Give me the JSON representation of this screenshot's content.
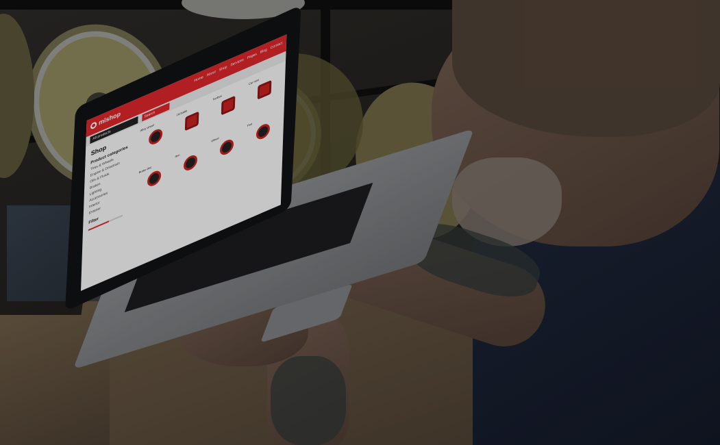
{
  "scene": {
    "description_hidden": "",
    "wall_color": "#2a2826"
  },
  "screen": {
    "brand": {
      "logo": "mlshop",
      "accent": "#d9262a"
    },
    "nav": [
      "Home",
      "About",
      "Shop",
      "Services",
      "Pages",
      "Blog",
      "Contact"
    ],
    "category_button": "All products",
    "search_button": "Search",
    "sidebar": {
      "shop_title": "Shop",
      "categories_title": "Product categories",
      "categories": [
        "Tires & Wheels",
        "Engine & Drivetrain",
        "Oils & Fluids",
        "Brakes",
        "Lighting",
        "Accessories",
        "Interior",
        "Exterior"
      ],
      "filter_title": "Filter"
    },
    "products": [
      {
        "title": "Alloy wheel",
        "price": "",
        "shape": "wheel"
      },
      {
        "title": "Oil bottle",
        "price": "",
        "shape": "square"
      },
      {
        "title": "Toolbox",
        "price": "",
        "shape": "square"
      },
      {
        "title": "Car mini",
        "price": "",
        "shape": "square"
      },
      {
        "title": "Brake disc",
        "price": "",
        "shape": "wheel"
      },
      {
        "title": "Rim",
        "price": "",
        "shape": "wheel"
      },
      {
        "title": "Wheel",
        "price": "",
        "shape": "wheel"
      },
      {
        "title": "Part",
        "price": "",
        "shape": "wheel"
      }
    ]
  }
}
